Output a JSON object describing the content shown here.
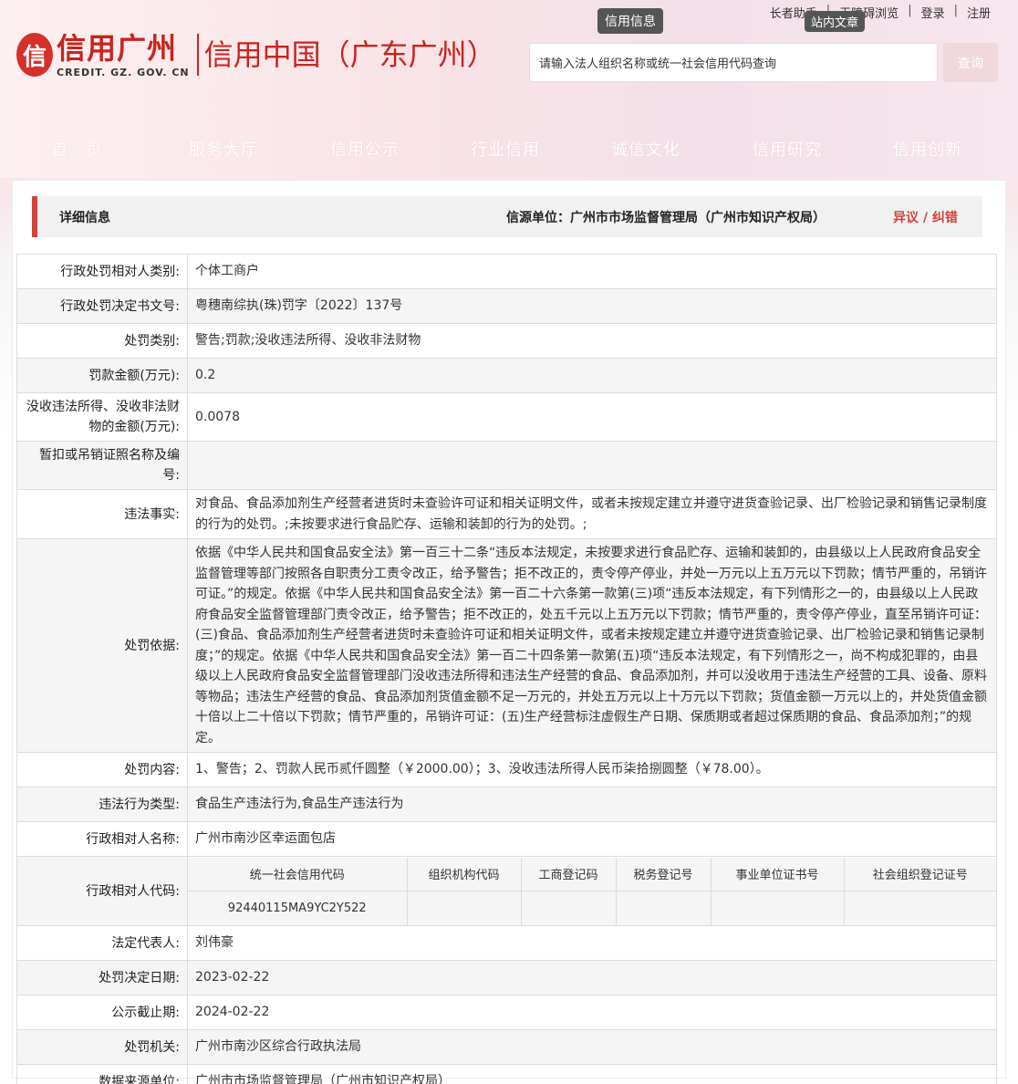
{
  "header": {
    "logo_mark": "信",
    "logo_cn": "信用广州",
    "logo_en": "CREDIT. GZ. GOV. CN",
    "logo_sub": "信用中国（广东广州）",
    "top_links": [
      "长者助手",
      "无障碍浏览",
      "登录",
      "注册"
    ],
    "pill_info": "信用信息",
    "pill_site": "站内文章",
    "search_placeholder": "请输入法人组织名称或统一社会信用代码查询",
    "search_button": "查询"
  },
  "nav": [
    "首　页",
    "服务大厅",
    "信用公示",
    "行业信用",
    "诚信文化",
    "信用研究",
    "信用创新"
  ],
  "detail": {
    "title": "详细信息",
    "source": "信源单位：广州市市场监督管理局（广州市知识产权局）",
    "dispute": "异议 / 纠错"
  },
  "rows": [
    {
      "label": "行政处罚相对人类别:",
      "value": "个体工商户"
    },
    {
      "label": "行政处罚决定书文号:",
      "value": "粤穗南综执(珠)罚字〔2022〕137号"
    },
    {
      "label": "处罚类别:",
      "value": "警告;罚款;没收违法所得、没收非法财物"
    },
    {
      "label": "罚款金额(万元):",
      "value": "0.2"
    },
    {
      "label": "没收违法所得、没收非法财物的金额(万元):",
      "value": "0.0078"
    },
    {
      "label": "暂扣或吊销证照名称及编号:",
      "value": ""
    },
    {
      "label": "违法事实:",
      "value": "对食品、食品添加剂生产经营者进货时未查验许可证和相关证明文件，或者未按规定建立并遵守进货查验记录、出厂检验记录和销售记录制度的行为的处罚。;未按要求进行食品贮存、运输和装卸的行为的处罚。;"
    },
    {
      "label": "处罚依据:",
      "value": "依据《中华人民共和国食品安全法》第一百三十二条“违反本法规定，未按要求进行食品贮存、运输和装卸的，由县级以上人民政府食品安全监督管理等部门按照各自职责分工责令改正，给予警告；拒不改正的，责令停产停业，并处一万元以上五万元以下罚款；情节严重的，吊销许可证。”的规定。依据《中华人民共和国食品安全法》第一百二十六条第一款第(三)项“违反本法规定，有下列情形之一的，由县级以上人民政府食品安全监督管理部门责令改正，给予警告；拒不改正的，处五千元以上五万元以下罚款；情节严重的，责令停产停业，直至吊销许可证：(三)食品、食品添加剂生产经营者进货时未查验许可证和相关证明文件，或者未按规定建立并遵守进货查验记录、出厂检验记录和销售记录制度；”的规定。依据《中华人民共和国食品安全法》第一百二十四条第一款第(五)项“违反本法规定，有下列情形之一，尚不构成犯罪的，由县级以上人民政府食品安全监督管理部门没收违法所得和违法生产经营的食品、食品添加剂，并可以没收用于违法生产经营的工具、设备、原料等物品；违法生产经营的食品、食品添加剂货值金额不足一万元的，并处五万元以上十万元以下罚款；货值金额一万元以上的，并处货值金额十倍以上二十倍以下罚款；情节严重的，吊销许可证：(五)生产经营标注虚假生产日期、保质期或者超过保质期的食品、食品添加剂；”的规定。"
    },
    {
      "label": "处罚内容:",
      "value": "1、警告；2、罚款人民币贰仟圆整（￥2000.00）；3、没收违法所得人民币柒拾捌圆整（￥78.00）。"
    },
    {
      "label": "违法行为类型:",
      "value": "食品生产违法行为,食品生产违法行为"
    },
    {
      "label": "行政相对人名称:",
      "value": "广州市南沙区幸运面包店"
    }
  ],
  "codes": {
    "label": "行政相对人代码:",
    "headers": [
      "统一社会信用代码",
      "组织机构代码",
      "工商登记码",
      "税务登记号",
      "事业单位证书号",
      "社会组织登记证号"
    ],
    "values": [
      "92440115MA9YC2Y522",
      "",
      "",
      "",
      "",
      ""
    ]
  },
  "rows_after": [
    {
      "label": "法定代表人:",
      "value": "刘伟豪"
    },
    {
      "label": "处罚决定日期:",
      "value": "2023-02-22"
    },
    {
      "label": "公示截止期:",
      "value": "2024-02-22"
    },
    {
      "label": "处罚机关:",
      "value": "广州市南沙区综合行政执法局"
    },
    {
      "label": "数据来源单位:",
      "value": "广州市市场监督管理局（广州市知识产权局）"
    }
  ]
}
